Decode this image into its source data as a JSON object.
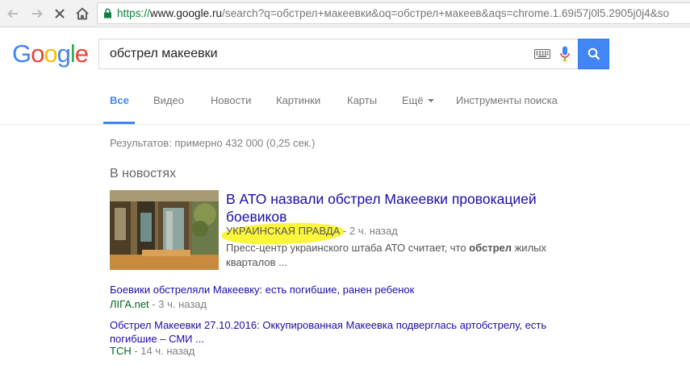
{
  "browser": {
    "url_scheme": "https://",
    "url_domain": "www.google.ru",
    "url_rest": "/search?q=обстрел+макеевки&oq=обстрел+макеев&aqs=chrome.1.69i57j0l5.2905j0j4&so"
  },
  "header": {
    "logo_letters": [
      "G",
      "o",
      "o",
      "g",
      "l",
      "e"
    ],
    "query": "обстрел макеевки"
  },
  "tabs": {
    "items": [
      {
        "label": "Все",
        "active": true
      },
      {
        "label": "Видео",
        "active": false
      },
      {
        "label": "Новости",
        "active": false
      },
      {
        "label": "Картинки",
        "active": false
      },
      {
        "label": "Карты",
        "active": false
      },
      {
        "label": "Ещё",
        "active": false
      }
    ],
    "tools_label": "Инструменты поиска"
  },
  "results": {
    "stats": "Результатов: примерно 432 000 (0,25 сек.)",
    "section_title": "В новостях",
    "top_story": {
      "title": "В АТО назвали обстрел Макеевки провокацией боевиков",
      "source": "УКРАИНСКАЯ ПРАВДА",
      "time": " - 2 ч. назад",
      "snippet_before": "Пресс-центр украинского штаба АТО считает, что ",
      "snippet_bold": "обстрел",
      "snippet_after": " жилых кварталов ..."
    },
    "more_stories": [
      {
        "title": "Боевики обстреляли Макеевку: есть погибшие, ранен ребенок",
        "source": "ЛІГА.net",
        "time": " - 3 ч. назад"
      },
      {
        "title": "Обстрел Макеевки 27.10.2016: Оккупированная Макеевка подверглась артобстрелу, есть погибшие – СМИ ...",
        "source": "ТСН",
        "time": " - 14 ч. назад"
      }
    ]
  },
  "colors": {
    "link": "#1a0dab",
    "accent": "#4285f4",
    "source_green": "#006621",
    "highlight": "#fbf53c"
  }
}
